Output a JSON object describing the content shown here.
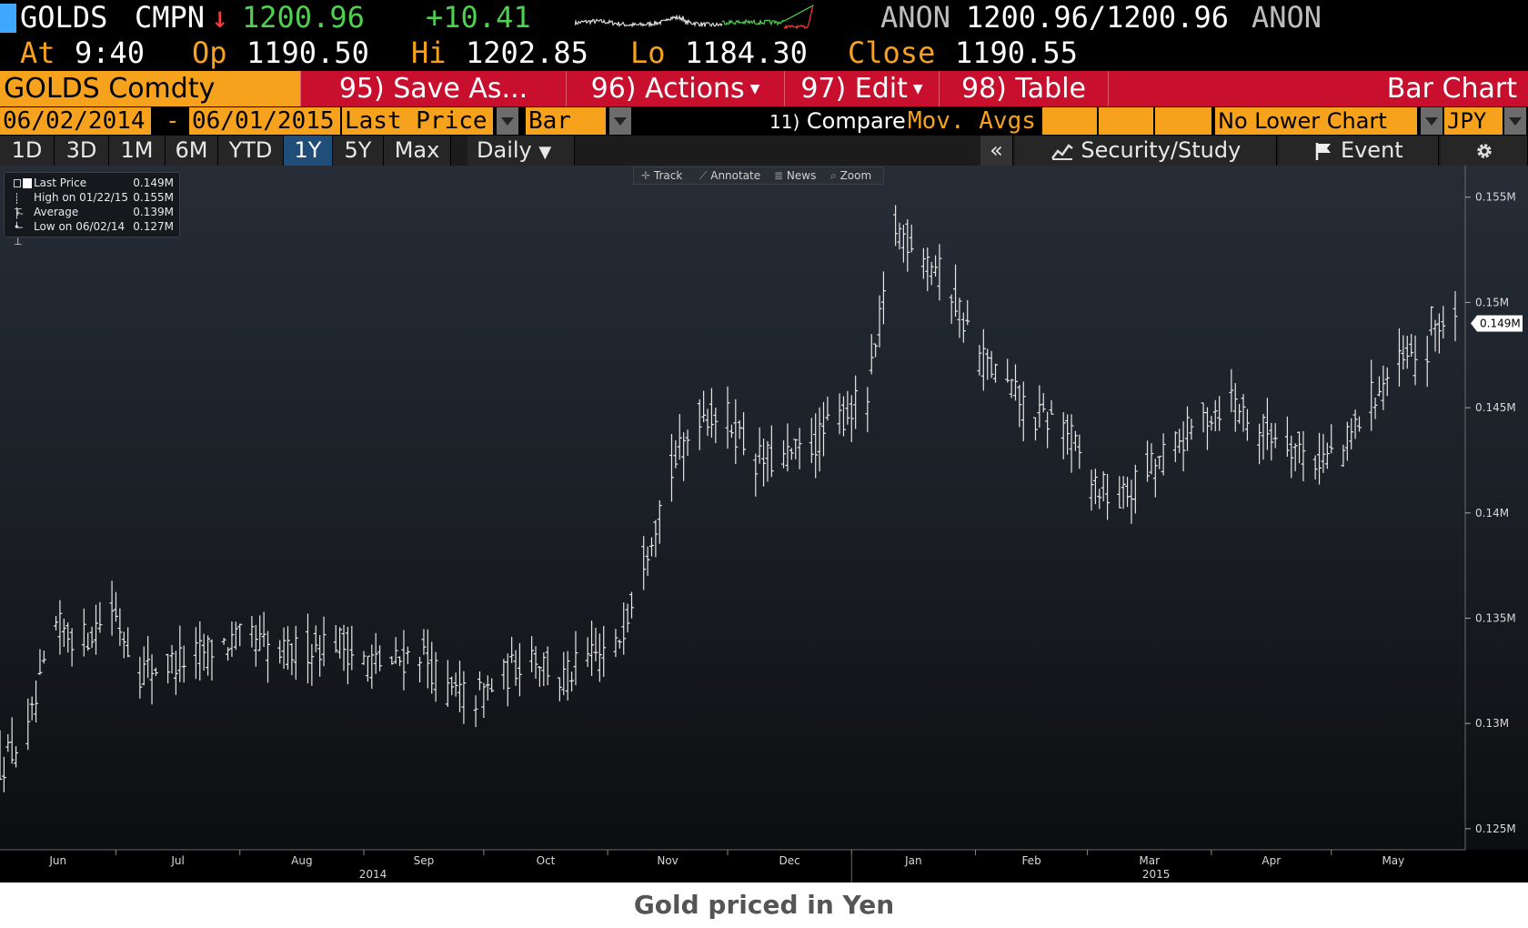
{
  "ticker": {
    "symbol": "GOLDS",
    "source": "CMPN",
    "arrow": "↓",
    "last": "1200.96",
    "change": "+10.41",
    "right_src": "ANON",
    "bid_ask": "1200.96/1200.96",
    "right_src2": "ANON",
    "at_label": "At",
    "time": "9:40",
    "op_label": "Op",
    "open": "1190.50",
    "hi_label": "Hi",
    "high": "1202.85",
    "lo_label": "Lo",
    "low": "1184.30",
    "close_label": "Close",
    "close": "1190.55"
  },
  "menu": {
    "security": "GOLDS Comdty",
    "save_as": "95) Save As...",
    "actions": "96) Actions",
    "edit": "97) Edit",
    "table": "98) Table",
    "chart_type": "Bar Chart"
  },
  "fields": {
    "start_date": "06/02/2014",
    "dash": "-",
    "end_date": "06/01/2015",
    "price_field": "Last Price",
    "style": "Bar",
    "compare": "Compare",
    "compare_num": "11)",
    "mov_avgs": "Mov. Avgs",
    "lower_chart": "No Lower Chart",
    "currency": "JPY"
  },
  "ranges": {
    "items": [
      "1D",
      "3D",
      "1M",
      "6M",
      "YTD",
      "1Y",
      "5Y",
      "Max"
    ],
    "active": "1Y",
    "period": "Daily",
    "collapse": "«",
    "security_study": "Security/Study",
    "event": "Event"
  },
  "mini_toolbar": {
    "track": "Track",
    "annotate": "Annotate",
    "news": "News",
    "zoom": "Zoom"
  },
  "legend": {
    "last_label": "Last Price",
    "last_value": "0.149M",
    "high_label": "High on 01/22/15",
    "high_value": "0.155M",
    "avg_label": "Average",
    "avg_value": "0.139M",
    "low_label": "Low on 06/02/14",
    "low_value": "0.127M"
  },
  "colors": {
    "accent_orange": "#f7a21c",
    "menu_red": "#c8102e",
    "up_green": "#4fd050",
    "down_red": "#ff3b3b"
  },
  "chart_data": {
    "type": "bar",
    "subtype": "ohlc",
    "title": "",
    "xlabel": "",
    "ylabel": "",
    "ylim": [
      0.124,
      0.1565
    ],
    "y_ticks": [
      0.125,
      0.13,
      0.135,
      0.14,
      0.145,
      0.15,
      0.155
    ],
    "y_tick_labels": [
      "0.125M",
      "0.13M",
      "0.135M",
      "0.14M",
      "0.145M",
      "0.15M",
      "0.155M"
    ],
    "last_price_label": "0.149M",
    "last_price": 0.149,
    "x_months": [
      "Jun",
      "Jul",
      "Aug",
      "Sep",
      "Oct",
      "Nov",
      "Dec",
      "Jan",
      "Feb",
      "Mar",
      "Apr",
      "May"
    ],
    "x_years": [
      "2014",
      "2015"
    ],
    "series": [
      {
        "dates": [
          "2014-06-02",
          "2014-06-09",
          "2014-06-16",
          "2014-06-23",
          "2014-06-30",
          "2014-07-07",
          "2014-07-14",
          "2014-07-21",
          "2014-07-28",
          "2014-08-04",
          "2014-08-11",
          "2014-08-18",
          "2014-08-25",
          "2014-09-01",
          "2014-09-08",
          "2014-09-15",
          "2014-09-22",
          "2014-09-29",
          "2014-10-06",
          "2014-10-13",
          "2014-10-20",
          "2014-10-27",
          "2014-11-03",
          "2014-11-10",
          "2014-11-17",
          "2014-11-24",
          "2014-12-01",
          "2014-12-08",
          "2014-12-15",
          "2014-12-22",
          "2014-12-29",
          "2015-01-05",
          "2015-01-12",
          "2015-01-19",
          "2015-01-26",
          "2015-02-02",
          "2015-02-09",
          "2015-02-16",
          "2015-02-23",
          "2015-03-02",
          "2015-03-09",
          "2015-03-16",
          "2015-03-23",
          "2015-03-30",
          "2015-04-06",
          "2015-04-13",
          "2015-04-20",
          "2015-04-27",
          "2015-05-04",
          "2015-05-11",
          "2015-05-18",
          "2015-05-25"
        ],
        "values": [
          0.128,
          0.1295,
          0.1345,
          0.134,
          0.1355,
          0.1325,
          0.1328,
          0.1332,
          0.1338,
          0.134,
          0.1332,
          0.1336,
          0.134,
          0.133,
          0.1328,
          0.1335,
          0.1315,
          0.1312,
          0.1322,
          0.1335,
          0.132,
          0.133,
          0.1335,
          0.138,
          0.142,
          0.1448,
          0.1445,
          0.1425,
          0.1425,
          0.1432,
          0.1445,
          0.1455,
          0.1535,
          0.1525,
          0.1505,
          0.1475,
          0.146,
          0.1445,
          0.1443,
          0.1415,
          0.1405,
          0.142,
          0.1432,
          0.1445,
          0.1455,
          0.144,
          0.1435,
          0.1425,
          0.143,
          0.1455,
          0.147,
          0.1475
        ]
      }
    ]
  },
  "caption": "Gold priced in Yen"
}
